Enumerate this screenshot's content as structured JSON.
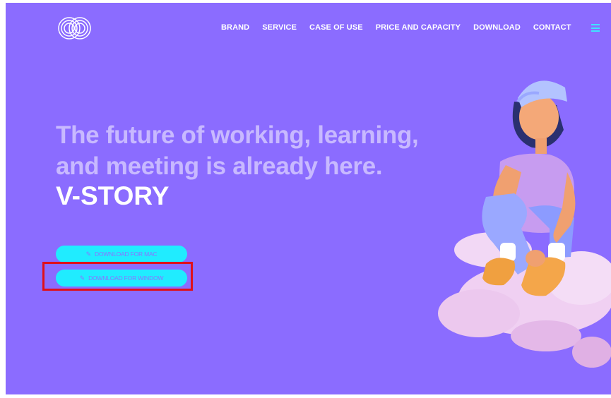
{
  "nav": {
    "items": [
      "BRAND",
      "SERVICE",
      "CASE OF USE",
      "PRICE AND CAPACITY",
      "DOWNLOAD",
      "CONTACT"
    ]
  },
  "hero": {
    "headline_line1": "The future of working, learning,",
    "headline_line2": "and meeting is already here.",
    "brand": "V-STORY"
  },
  "buttons": {
    "mac": "DOWNLOAD FOR MAC",
    "windows": "DOWNLOAD FOR WINDOW"
  },
  "icons": {
    "logo": "concentric-rings-logo-icon",
    "menu": "hamburger-menu-icon",
    "button": "pencil-icon"
  },
  "colors": {
    "background": "#8b6cff",
    "button": "#20ecff",
    "headline": "#c8b9ff",
    "highlight": "#e0101a"
  }
}
